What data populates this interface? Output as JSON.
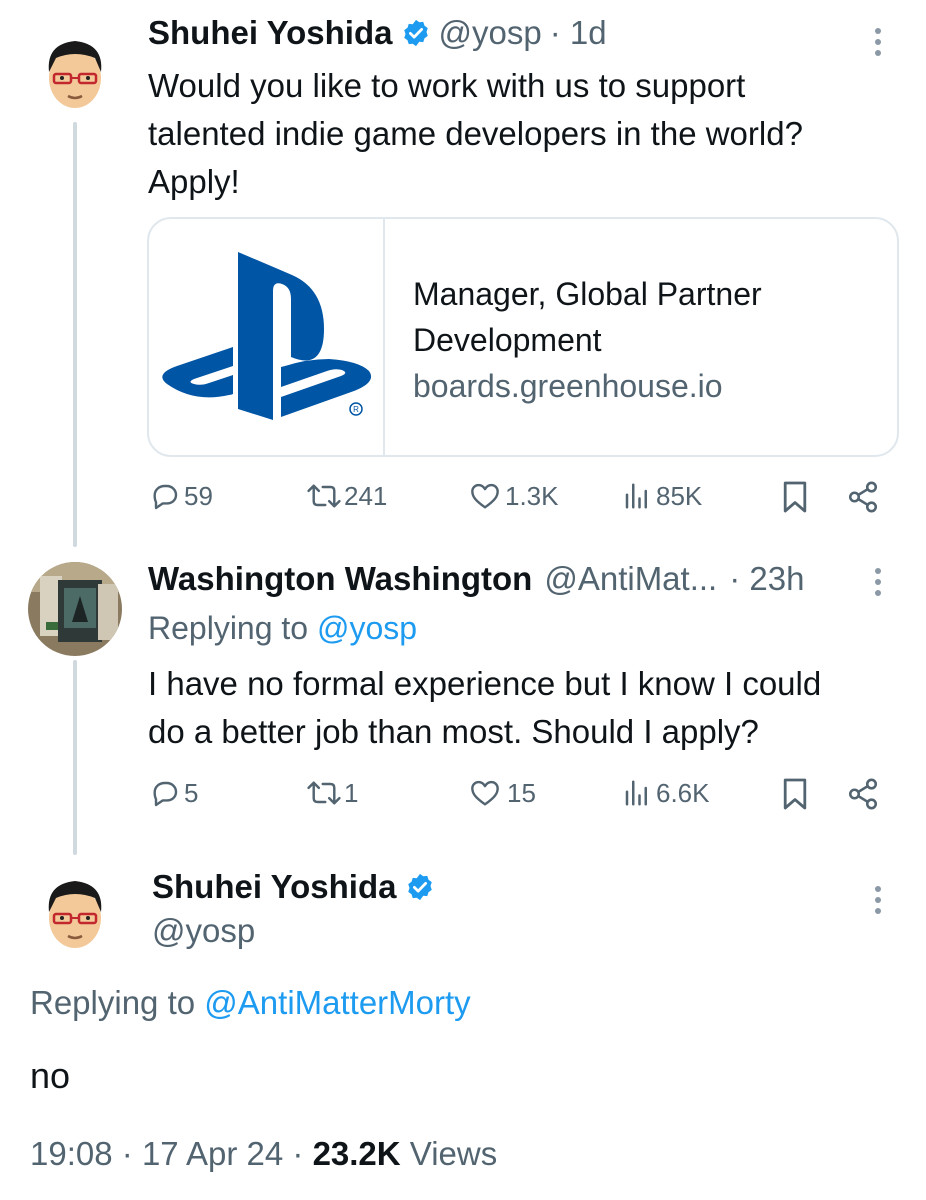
{
  "tweet1": {
    "name": "Shuhei Yoshida",
    "handle": "@yosp",
    "time": "· 1d",
    "text_lines": [
      "Would you like to work with us to support",
      "talented indie game developers in the world?",
      "Apply!"
    ],
    "card": {
      "title_line1": "Manager, Global Partner",
      "title_line2": "Development",
      "domain": "boards.greenhouse.io"
    },
    "actions": {
      "replies": "59",
      "retweets": "241",
      "likes": "1.3K",
      "views": "85K"
    }
  },
  "tweet2": {
    "name": "Washington Washington",
    "handle": "@AntiMat...",
    "time": "· 23h",
    "replying_label": "Replying to",
    "replying_handle": "@yosp",
    "text_lines": [
      "I have no formal experience but I know I could",
      "do a better job than most. Should I apply?"
    ],
    "actions": {
      "replies": "5",
      "retweets": "1",
      "likes": "15",
      "views": "6.6K"
    }
  },
  "main_tweet": {
    "name": "Shuhei Yoshida",
    "handle": "@yosp",
    "replying_label": "Replying to",
    "replying_handle": "@AntiMatterMorty",
    "text": "no",
    "time": "19:08",
    "date": "17 Apr 24",
    "views_count": "23.2K",
    "views_label": "Views"
  },
  "colors": {
    "verified": "#1d9bf0",
    "link": "#1d9bf0",
    "muted": "#536471",
    "playstation_blue": "#0055a5"
  },
  "icons": [
    "verified-badge-icon",
    "more-icon",
    "reply-icon",
    "retweet-icon",
    "like-icon",
    "views-icon",
    "bookmark-icon",
    "share-icon",
    "playstation-logo"
  ]
}
